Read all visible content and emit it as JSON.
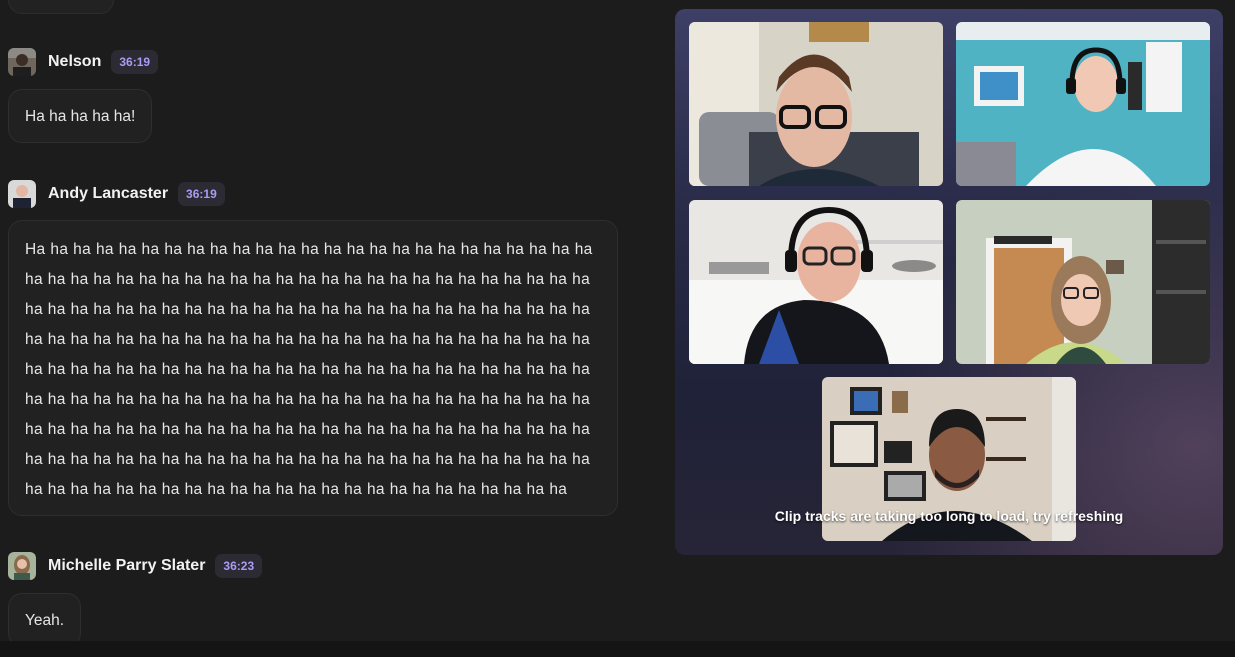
{
  "transcript": {
    "messages": [
      {
        "speaker": "Nelson",
        "time": "36:19",
        "text": "Ha ha ha ha ha!"
      },
      {
        "speaker": "Andy Lancaster",
        "time": "36:19",
        "lines": [
          "Ha ha ha ha ha ha ha ha ha ha ha ha ha ha ha ha ha ha ha ha ha ha ha ha ha",
          "ha ha ha ha ha ha ha ha ha ha ha ha ha ha ha ha ha ha ha ha ha ha ha ha ha",
          "ha ha ha ha ha ha ha ha ha ha ha ha ha ha ha ha ha ha ha ha ha ha ha ha ha",
          "ha ha ha ha ha ha ha ha ha ha ha ha ha ha ha ha ha ha ha ha ha ha ha ha ha",
          "ha ha ha ha ha ha ha ha ha ha ha ha ha ha ha ha ha ha ha ha ha ha ha ha ha",
          "ha ha ha ha ha ha ha ha ha ha ha ha ha ha ha ha ha ha ha ha ha ha ha ha ha",
          "ha ha ha ha ha ha ha ha ha ha ha ha ha ha ha ha ha ha ha ha ha ha ha ha ha",
          "ha ha ha ha ha ha ha ha ha ha ha ha ha ha ha ha ha ha ha ha ha ha ha ha ha",
          "ha ha ha ha ha ha ha ha ha ha ha ha ha ha ha ha ha ha ha ha ha ha ha ha"
        ]
      },
      {
        "speaker": "Michelle Parry Slater",
        "time": "36:23",
        "text": "Yeah."
      }
    ]
  },
  "video": {
    "caption": "Clip tracks are taking too long to load, try refreshing"
  },
  "colors": {
    "background": "#1c1c1c",
    "bubble": "#212121",
    "timestamp_bg": "#2c2b33",
    "timestamp_text": "#a99cf5",
    "panel_top": "#3e3f66"
  }
}
